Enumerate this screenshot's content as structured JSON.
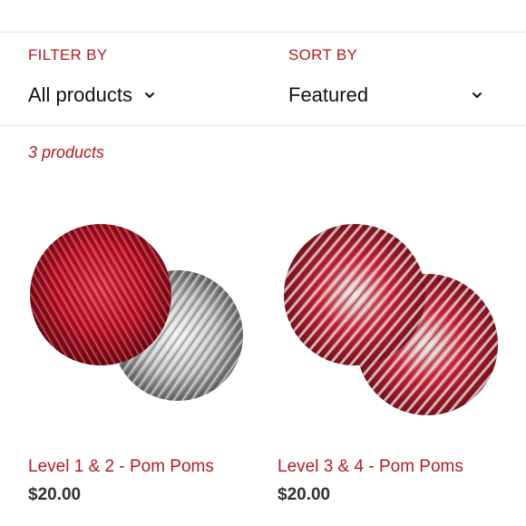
{
  "filters": {
    "filter_by": {
      "label": "FILTER BY",
      "value": "All products"
    },
    "sort_by": {
      "label": "SORT BY",
      "value": "Featured"
    }
  },
  "product_count": "3 products",
  "products": [
    {
      "title": "Level 1 & 2 - Pom Poms",
      "price": "$20.00",
      "image": "red-and-silver-pom-poms"
    },
    {
      "title": "Level 3 & 4 - Pom Poms",
      "price": "$20.00",
      "image": "red-silver-mixed-pom-poms"
    }
  ],
  "colors": {
    "accent": "#b31b24",
    "price": "#333333",
    "rule": "#e6e6e6"
  }
}
